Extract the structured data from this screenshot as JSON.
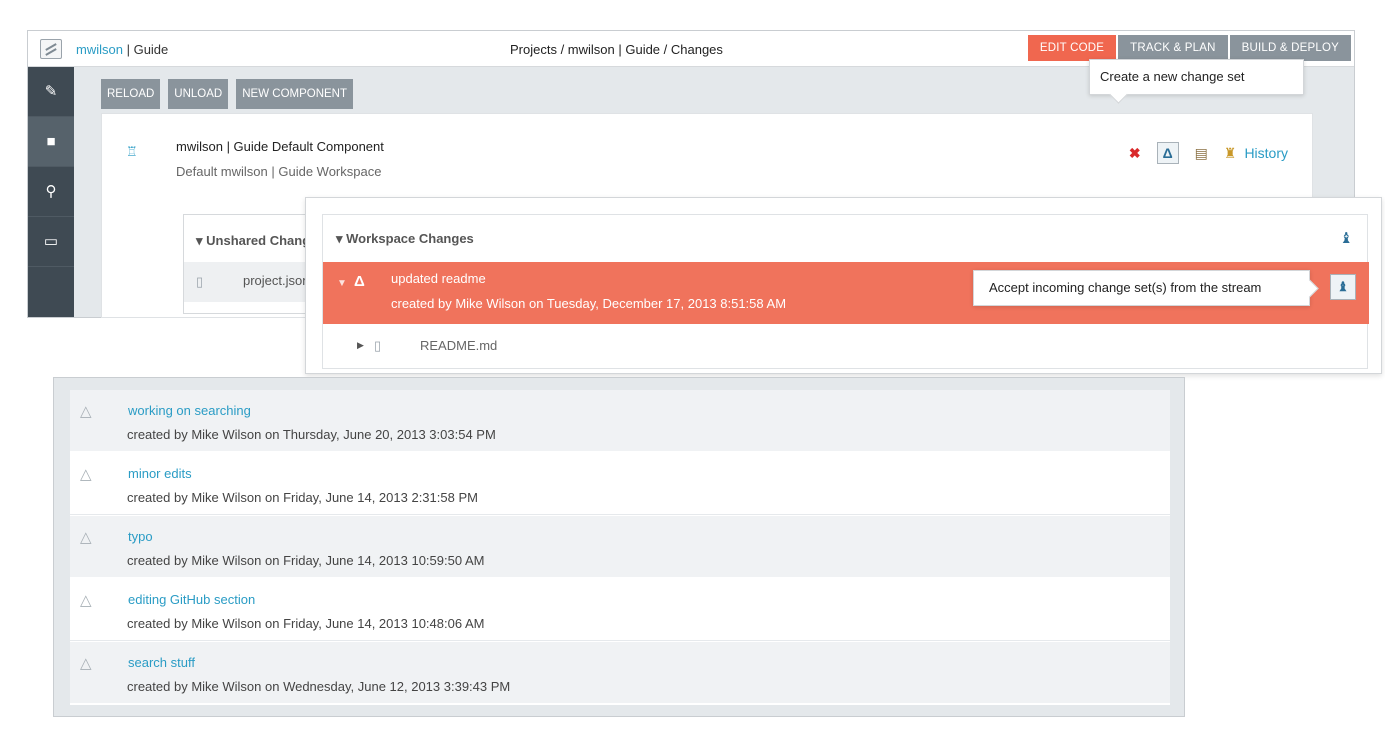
{
  "header": {
    "project_link": "mwilson",
    "project_sep": " | ",
    "project_name": "Guide",
    "breadcrumb": "Projects / mwilson | Guide / Changes",
    "tabs": [
      {
        "label": "EDIT CODE",
        "active": true
      },
      {
        "label": "TRACK & PLAN",
        "active": false
      },
      {
        "label": "BUILD & DEPLOY",
        "active": false
      }
    ]
  },
  "sidebar": {
    "items": [
      {
        "icon": "pencil-icon",
        "glyph": "✎"
      },
      {
        "icon": "repository-icon",
        "glyph": "■"
      },
      {
        "icon": "search-icon",
        "glyph": "⚲"
      },
      {
        "icon": "console-icon",
        "glyph": "▭"
      }
    ]
  },
  "toolbar": {
    "reload": "RELOAD",
    "unload": "UNLOAD",
    "new_component": "NEW COMPONENT"
  },
  "component": {
    "title": "mwilson | Guide Default Component",
    "subtitle": "Default mwilson | Guide Workspace",
    "history_label": "History",
    "tooltip": "Create a new change set"
  },
  "unshared": {
    "header": "▾ Unshared Changes",
    "file": "project.json"
  },
  "workspace": {
    "header": "▾ Workspace Changes",
    "change": {
      "title": "updated readme",
      "meta": "created by Mike Wilson on Tuesday, December 17, 2013 8:51:58 AM"
    },
    "tooltip": "Accept incoming change set(s) from the stream",
    "file": "README.md"
  },
  "history": [
    {
      "title": "working on searching",
      "meta": "created by Mike Wilson on Thursday, June 20, 2013 3:03:54 PM"
    },
    {
      "title": "minor edits",
      "meta": "created by Mike Wilson on Friday, June 14, 2013 2:31:58 PM"
    },
    {
      "title": "typo",
      "meta": "created by Mike Wilson on Friday, June 14, 2013 10:59:50 AM"
    },
    {
      "title": "editing GitHub section",
      "meta": "created by Mike Wilson on Friday, June 14, 2013 10:48:06 AM"
    },
    {
      "title": "search stuff",
      "meta": "created by Mike Wilson on Wednesday, June 12, 2013 3:39:43 PM"
    }
  ],
  "colors": {
    "accent": "#f0674f",
    "link": "#2a9cc5",
    "nav_dark": "#3f4a53",
    "tab_gray": "#8a949c"
  }
}
